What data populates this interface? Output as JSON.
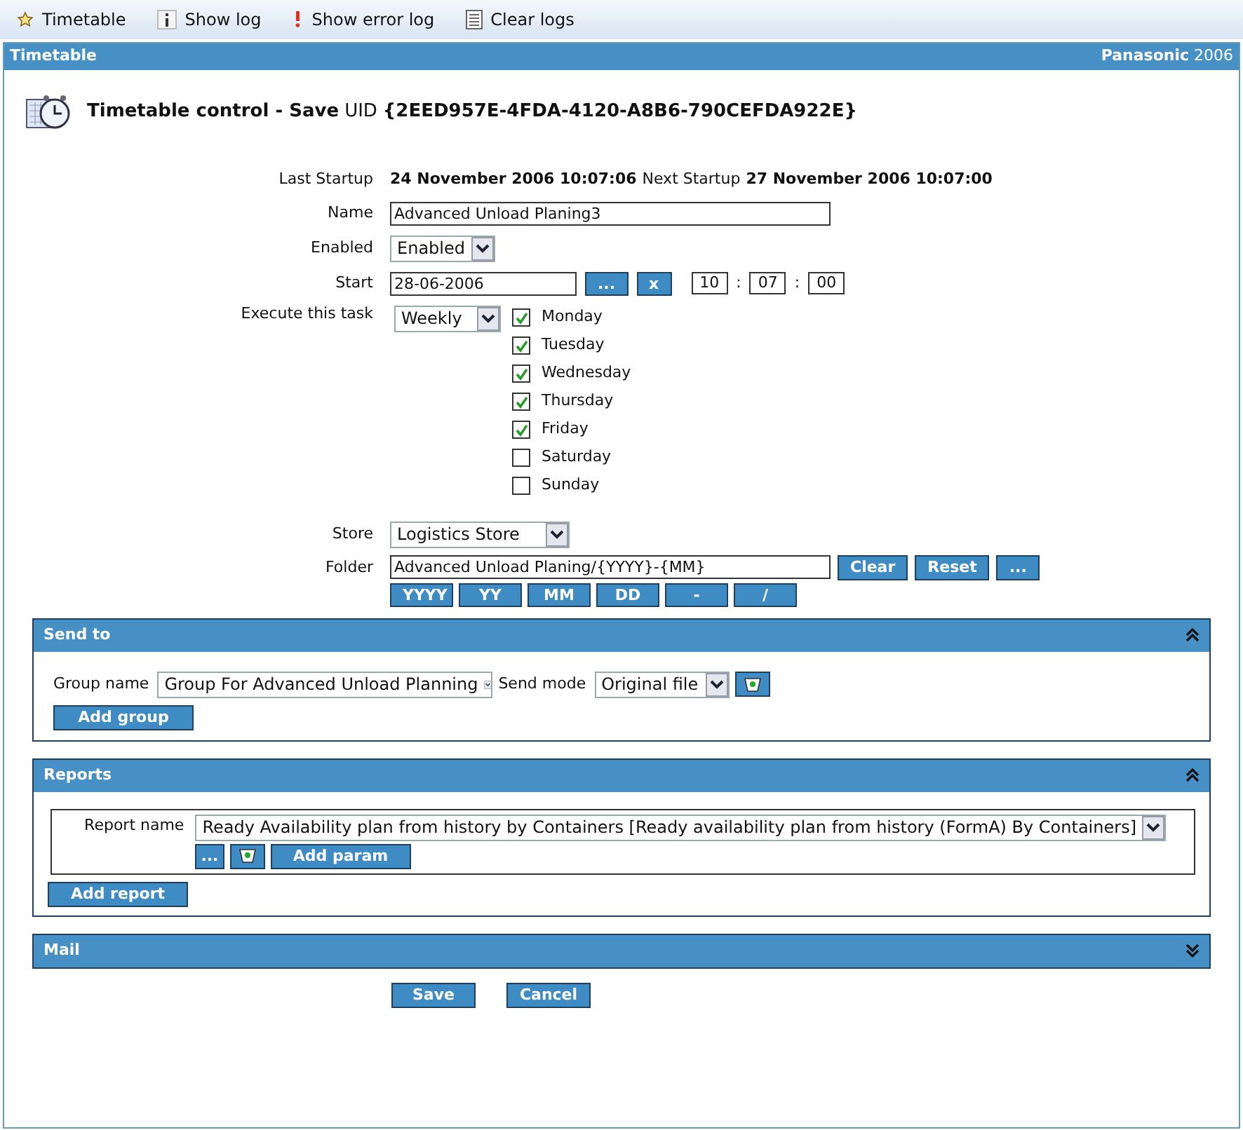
{
  "toolbar": [
    {
      "label": "Timetable",
      "kind": "star"
    },
    {
      "label": "Show log",
      "kind": "info"
    },
    {
      "label": "Show error log",
      "kind": "error"
    },
    {
      "label": "Clear logs",
      "kind": "clear"
    }
  ],
  "panel": {
    "title": "Timetable",
    "brand": "**Panasonic** 2006"
  },
  "heading": {
    "title": "Timetable control - Save",
    "uid_label": "UID",
    "uid": "{2EED957E-4FDA-4120-A8B6-790CEFDA922E}"
  },
  "startup": {
    "label": "Last Startup",
    "last": "24 November 2006 10:07:06",
    "next_label": "Next Startup",
    "next": "27 November 2006 10:07:00"
  },
  "name": {
    "label": "Name",
    "value": "Advanced Unload Planing3"
  },
  "enabled": {
    "label": "Enabled",
    "value": "Enabled"
  },
  "start": {
    "label": "Start",
    "date": "28-06-2006",
    "pick": "...",
    "clear": "x",
    "hour": "10",
    "minute": "07",
    "second": "00",
    "sep": ":"
  },
  "execute": {
    "label": "Execute this task",
    "value": "Weekly",
    "days": [
      {
        "label": "Monday",
        "checked": true
      },
      {
        "label": "Tuesday",
        "checked": true
      },
      {
        "label": "Wednesday",
        "checked": true
      },
      {
        "label": "Thursday",
        "checked": true
      },
      {
        "label": "Friday",
        "checked": true
      },
      {
        "label": "Saturday",
        "checked": false
      },
      {
        "label": "Sunday",
        "checked": false
      }
    ]
  },
  "store": {
    "label": "Store",
    "value": "Logistics Store"
  },
  "folder": {
    "label": "Folder",
    "value": "Advanced Unload Planing/{YYYY}-{MM}",
    "buttons": [
      "Clear",
      "Reset",
      "..."
    ],
    "tokens": [
      "YYYY",
      "YY",
      "MM",
      "DD",
      "-",
      "/"
    ]
  },
  "send_to": {
    "title": "Send to",
    "expanded": true,
    "group_label": "Group name",
    "group": "Group For Advanced Unload Planning",
    "mode_label": "Send mode",
    "mode": "Original file",
    "add": "Add group"
  },
  "reports": {
    "title": "Reports",
    "expanded": true,
    "report_label": "Report name",
    "report": "Ready Availability plan from history by Containers [Ready availability plan from history (FormA) By Containers]",
    "more": "...",
    "add_param": "Add param",
    "add": "Add report"
  },
  "mail": {
    "title": "Mail",
    "expanded": false
  },
  "actions": [
    "Save",
    "Cancel"
  ]
}
